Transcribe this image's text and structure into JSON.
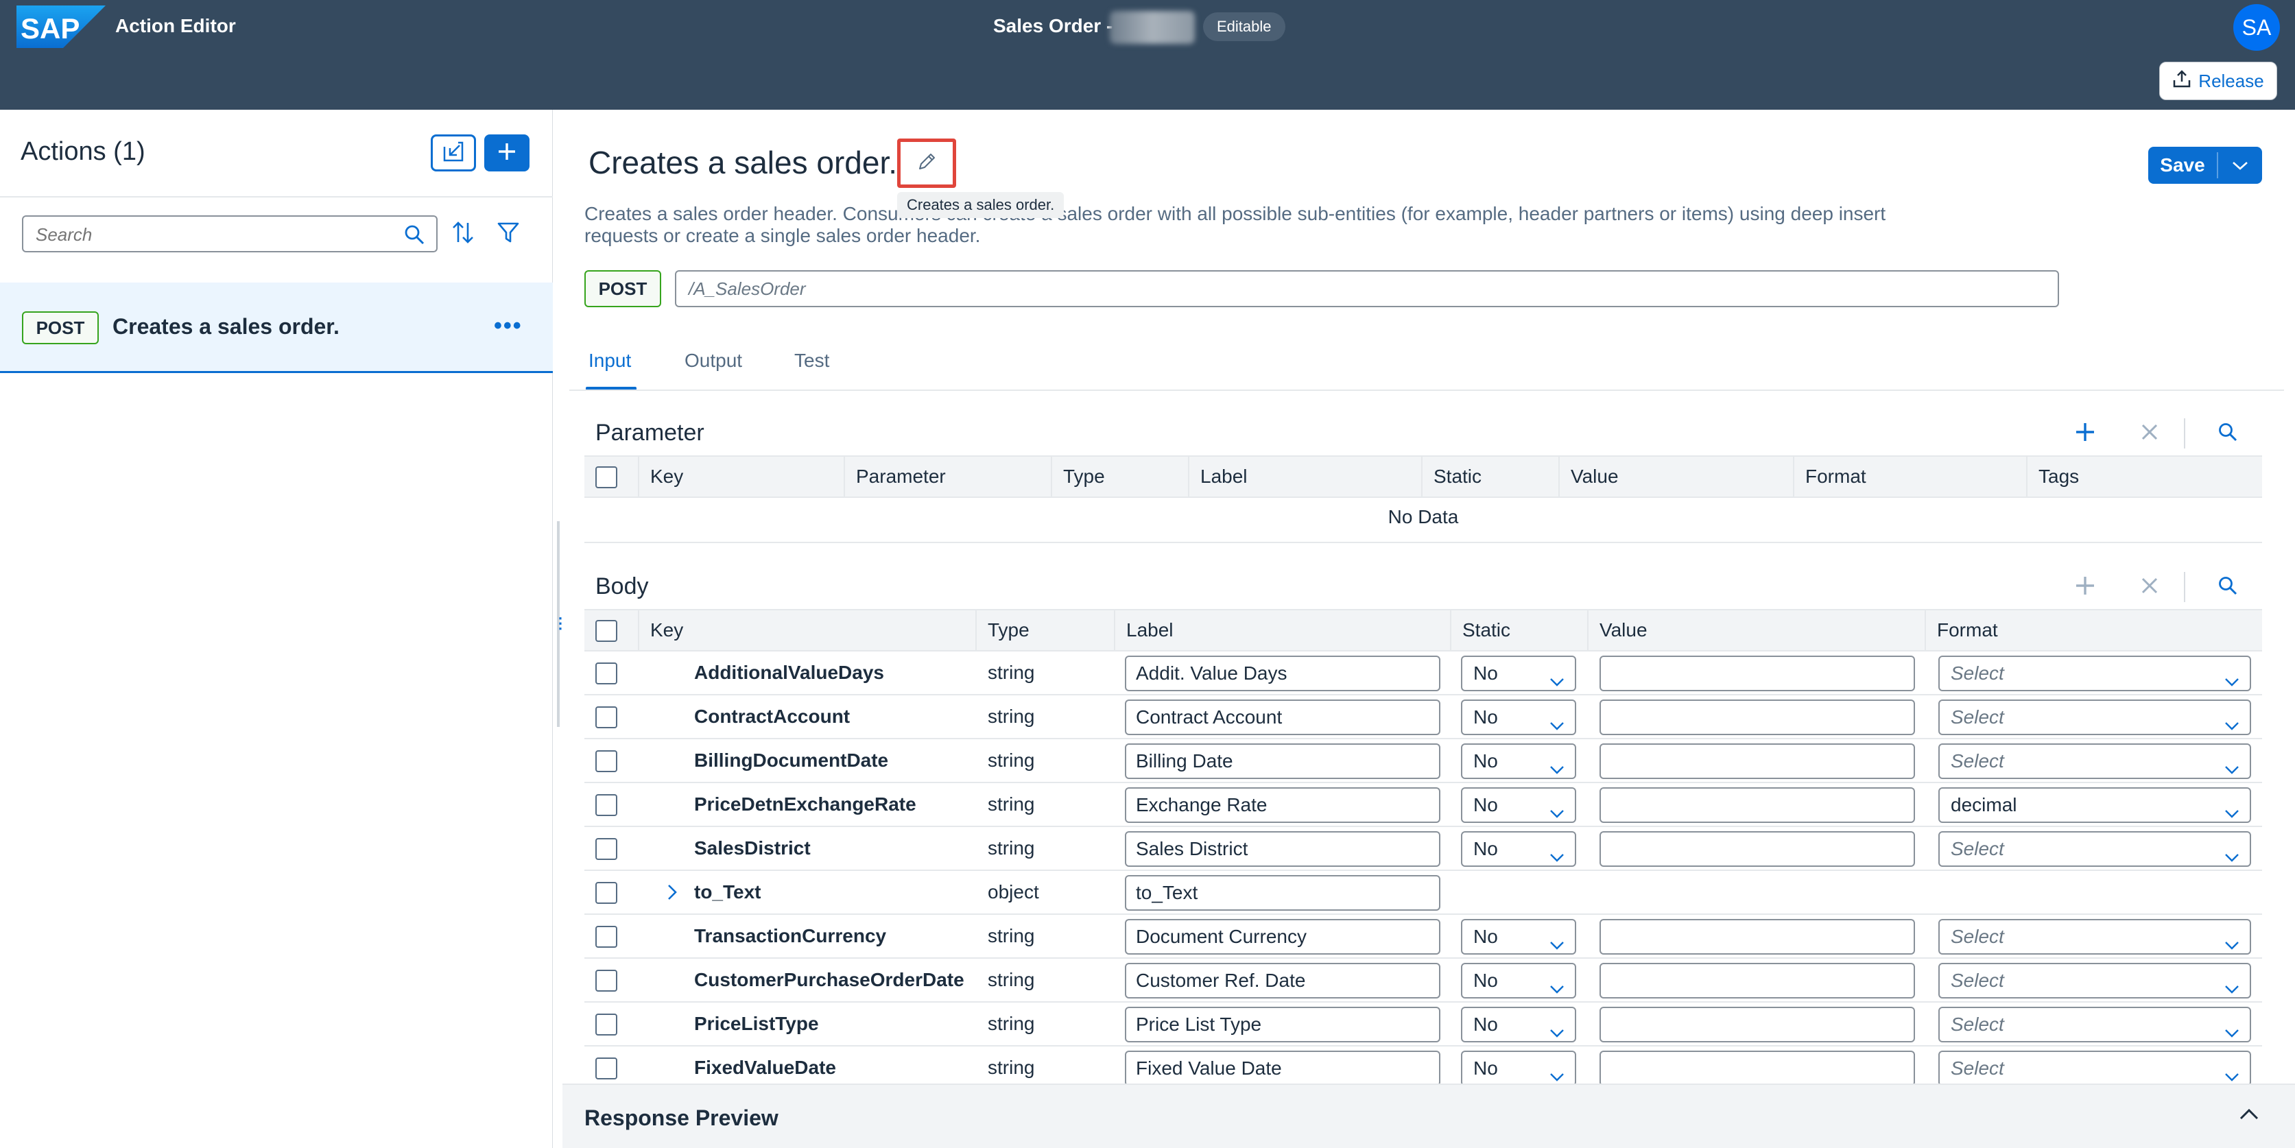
{
  "shell": {
    "logo_text": "SAP",
    "app_name": "Action Editor",
    "doc_title": "Sales Order -",
    "editable_badge": "Editable",
    "avatar_initials": "SA",
    "release_label": "Release"
  },
  "sidebar": {
    "title": "Actions (1)",
    "search_placeholder": "Search",
    "items": [
      {
        "method": "POST",
        "label": "Creates a sales order."
      }
    ]
  },
  "action": {
    "title": "Creates a sales order.",
    "tooltip": "Creates a sales order.",
    "save_label": "Save",
    "description": "Creates a sales order header. Consumers can create a sales order with all possible sub-entities (for example, header partners or items) using deep insert requests or create a single sales order header.",
    "method": "POST",
    "path": "/A_SalesOrder"
  },
  "tabs": [
    {
      "label": "Input",
      "selected": true
    },
    {
      "label": "Output",
      "selected": false
    },
    {
      "label": "Test",
      "selected": false
    }
  ],
  "parameter_table": {
    "title": "Parameter",
    "columns": [
      "Key",
      "Parameter",
      "Type",
      "Label",
      "Static",
      "Value",
      "Format",
      "Tags"
    ],
    "empty_text": "No Data"
  },
  "body_table": {
    "title": "Body",
    "columns": [
      "Key",
      "Type",
      "Label",
      "Static",
      "Value",
      "Format"
    ],
    "rows": [
      {
        "key": "AdditionalValueDays",
        "type": "string",
        "label": "Addit. Value Days",
        "static": "No",
        "value": "",
        "format": "Select"
      },
      {
        "key": "ContractAccount",
        "type": "string",
        "label": "Contract Account",
        "static": "No",
        "value": "",
        "format": "Select"
      },
      {
        "key": "BillingDocumentDate",
        "type": "string",
        "label": "Billing Date",
        "static": "No",
        "value": "",
        "format": "Select"
      },
      {
        "key": "PriceDetnExchangeRate",
        "type": "string",
        "label": "Exchange Rate",
        "static": "No",
        "value": "",
        "format": "decimal"
      },
      {
        "key": "SalesDistrict",
        "type": "string",
        "label": "Sales District",
        "static": "No",
        "value": "",
        "format": "Select"
      },
      {
        "key": "to_Text",
        "type": "object",
        "label": "to_Text",
        "static": "",
        "value": "",
        "format": "",
        "expandable": true
      },
      {
        "key": "TransactionCurrency",
        "type": "string",
        "label": "Document Currency",
        "static": "No",
        "value": "",
        "format": "Select"
      },
      {
        "key": "CustomerPurchaseOrderDate",
        "type": "string",
        "label": "Customer Ref. Date",
        "static": "No",
        "value": "",
        "format": "Select"
      },
      {
        "key": "PriceListType",
        "type": "string",
        "label": "Price List Type",
        "static": "No",
        "value": "",
        "format": "Select"
      },
      {
        "key": "FixedValueDate",
        "type": "string",
        "label": "Fixed Value Date",
        "static": "No",
        "value": "",
        "format": "Select"
      }
    ]
  },
  "response_preview": {
    "title": "Response Preview"
  },
  "colors": {
    "shell_bg": "#354a5f",
    "brand_blue": "#0a6ed1",
    "post_green": "#36a41d",
    "highlight_red": "#e0453b"
  }
}
